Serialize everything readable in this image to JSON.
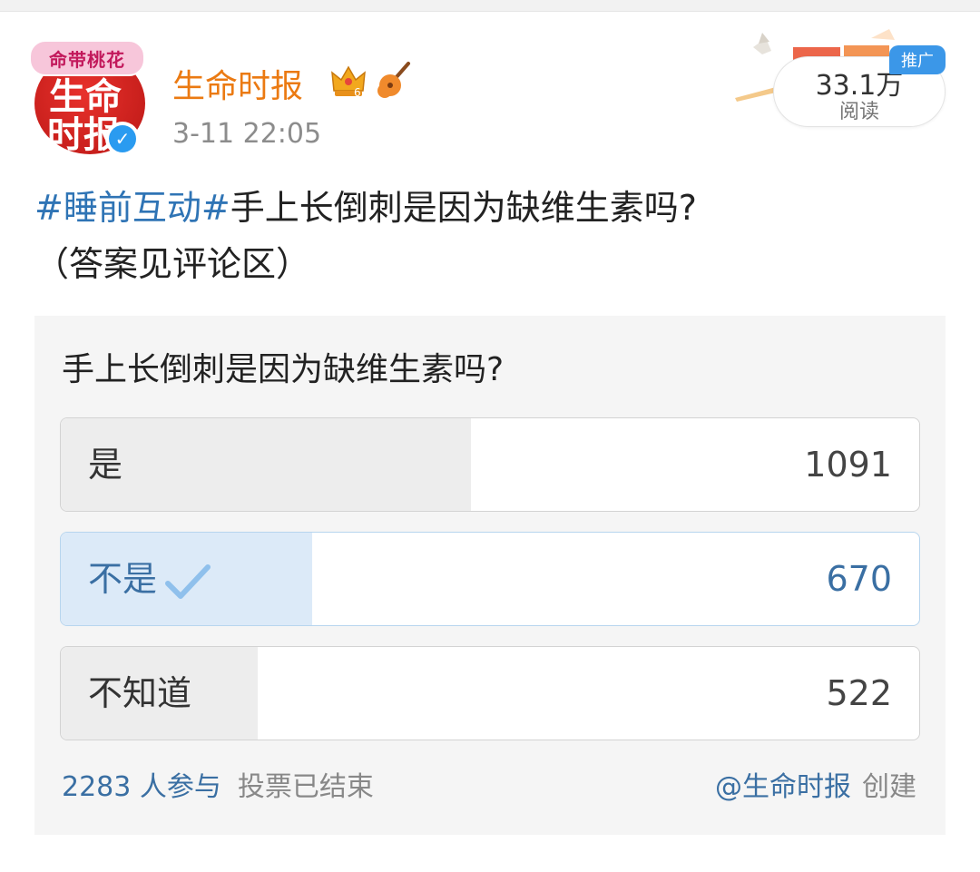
{
  "post": {
    "author": "生命时报",
    "avatar_banner": "命带桃花",
    "avatar_line1": "生命",
    "avatar_line2": "时报",
    "timestamp": "3-11 22:05",
    "read_count": "33.1万",
    "read_label": "阅读",
    "ad_tag": "推广",
    "hashtag": "#睡前互动#",
    "body_text": "手上长倒刺是因为缺维生素吗?",
    "body_note": "（答案见评论区）"
  },
  "poll": {
    "question": "手上长倒刺是因为缺维生素吗?",
    "options": [
      {
        "label": "是",
        "count": "1091",
        "share": 0.478,
        "selected": false
      },
      {
        "label": "不是",
        "count": "670",
        "share": 0.293,
        "selected": true
      },
      {
        "label": "不知道",
        "count": "522",
        "share": 0.229,
        "selected": false
      }
    ],
    "participants": "2283 人参与",
    "status": "投票已结束",
    "creator": "@生命时报",
    "created_label": "创建"
  },
  "colors": {
    "author": "#eb7a12",
    "link": "#2f74b5",
    "selected_fill": "#dceaf8",
    "ad_tag": "#3b97e8"
  },
  "icons": [
    "verified-badge-icon",
    "crown-icon",
    "guitar-icon",
    "checkmark-icon"
  ]
}
